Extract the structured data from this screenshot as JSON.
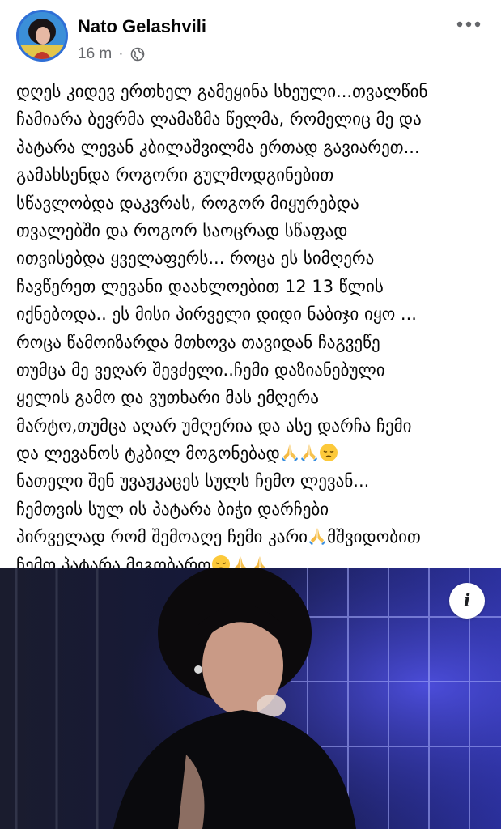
{
  "post": {
    "author": "Nato Gelashvili",
    "time": "16 m",
    "separator": "·",
    "audience_icon": "globe-icon",
    "more_icon": "more-options-icon",
    "text_lines": [
      [
        "დღეს კიდევ ერთხელ გამეყინა სხეული...თვალწინ"
      ],
      [
        "ჩამიარა ბევრმა ლამაზმა წელმა, რომელიც მე და"
      ],
      [
        "პატარა ლევან კბილაშვილმა ერთად გავიარეთ..."
      ],
      [
        "გამახსენდა როგორი გულმოდგინებით"
      ],
      [
        "სწავლობდა დაკვრას, როგორ მიყურებდა"
      ],
      [
        "თვალებში და როგორ საოცრად სწაფად"
      ],
      [
        "ითვისებდა ყველაფერს... როცა ეს სიმღერა"
      ],
      [
        "ჩავწერეთ ლევანი დაახლოებით 12 13 წლის"
      ],
      [
        "იქნებოდა.. ეს მისი პირველი დიდი ნაბიჯი იყო ..."
      ],
      [
        "როცა წამოიზარდა მთხოვა თავიდან ჩაგვეწე"
      ],
      [
        "თუმცა მე ვეღარ შევძელი..ჩემი დაზიანებული"
      ],
      [
        "ყელის გამო და ვუთხარი მას ემღერა"
      ],
      [
        "მარტო,თუმცა აღარ უმღერია და ასე დარჩა ჩემი"
      ],
      [
        "და ლევანოს ტკბილ მოგონებად"
      ],
      [
        "ნათელი შენ უვაჟკაცეს სულს ჩემო ლევან..."
      ],
      [
        "ჩემთვის სულ  ის პატარა ბიჭი დარჩები"
      ],
      [
        "პირველად რომ შემოაღე ჩემი კარი",
        "მშვიდობით"
      ],
      [
        "ჩემო პატარა მეგობარო"
      ]
    ],
    "emoji_names": {
      "pray": "folded-hands-emoji",
      "pensive": "pensive-face-emoji"
    },
    "photo": {
      "description_icon": "info-icon",
      "info_label": "i"
    }
  }
}
